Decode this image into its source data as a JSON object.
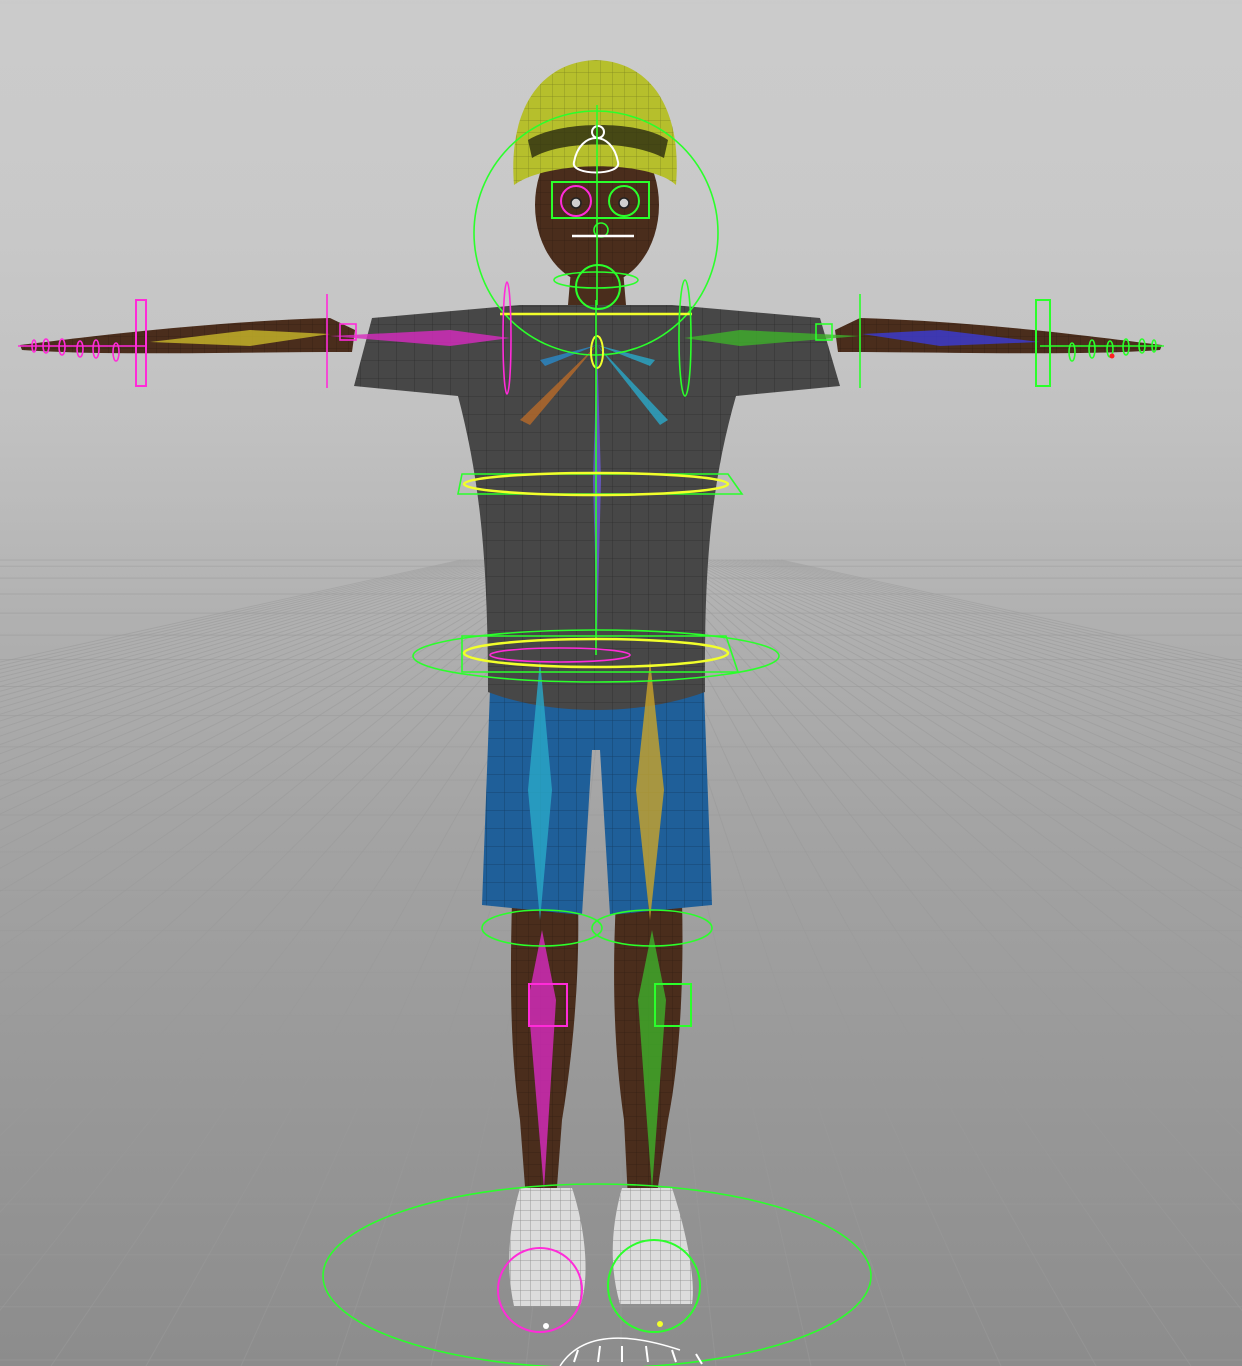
{
  "viewport": {
    "background_top": "#cbcbcb",
    "background_bottom": "#8c8c8c",
    "grid_color": "#9a9a9a"
  },
  "colors": {
    "skin": "#4a2d1c",
    "shirt": "#474747",
    "shorts": "#1f5f99",
    "cap": "#b6bf2c",
    "shoes": "#dcdcdc",
    "control_green": "#2bff2b",
    "control_magenta": "#ff2bd9",
    "control_yellow": "#f2ff2b",
    "control_white": "#ffffff"
  }
}
